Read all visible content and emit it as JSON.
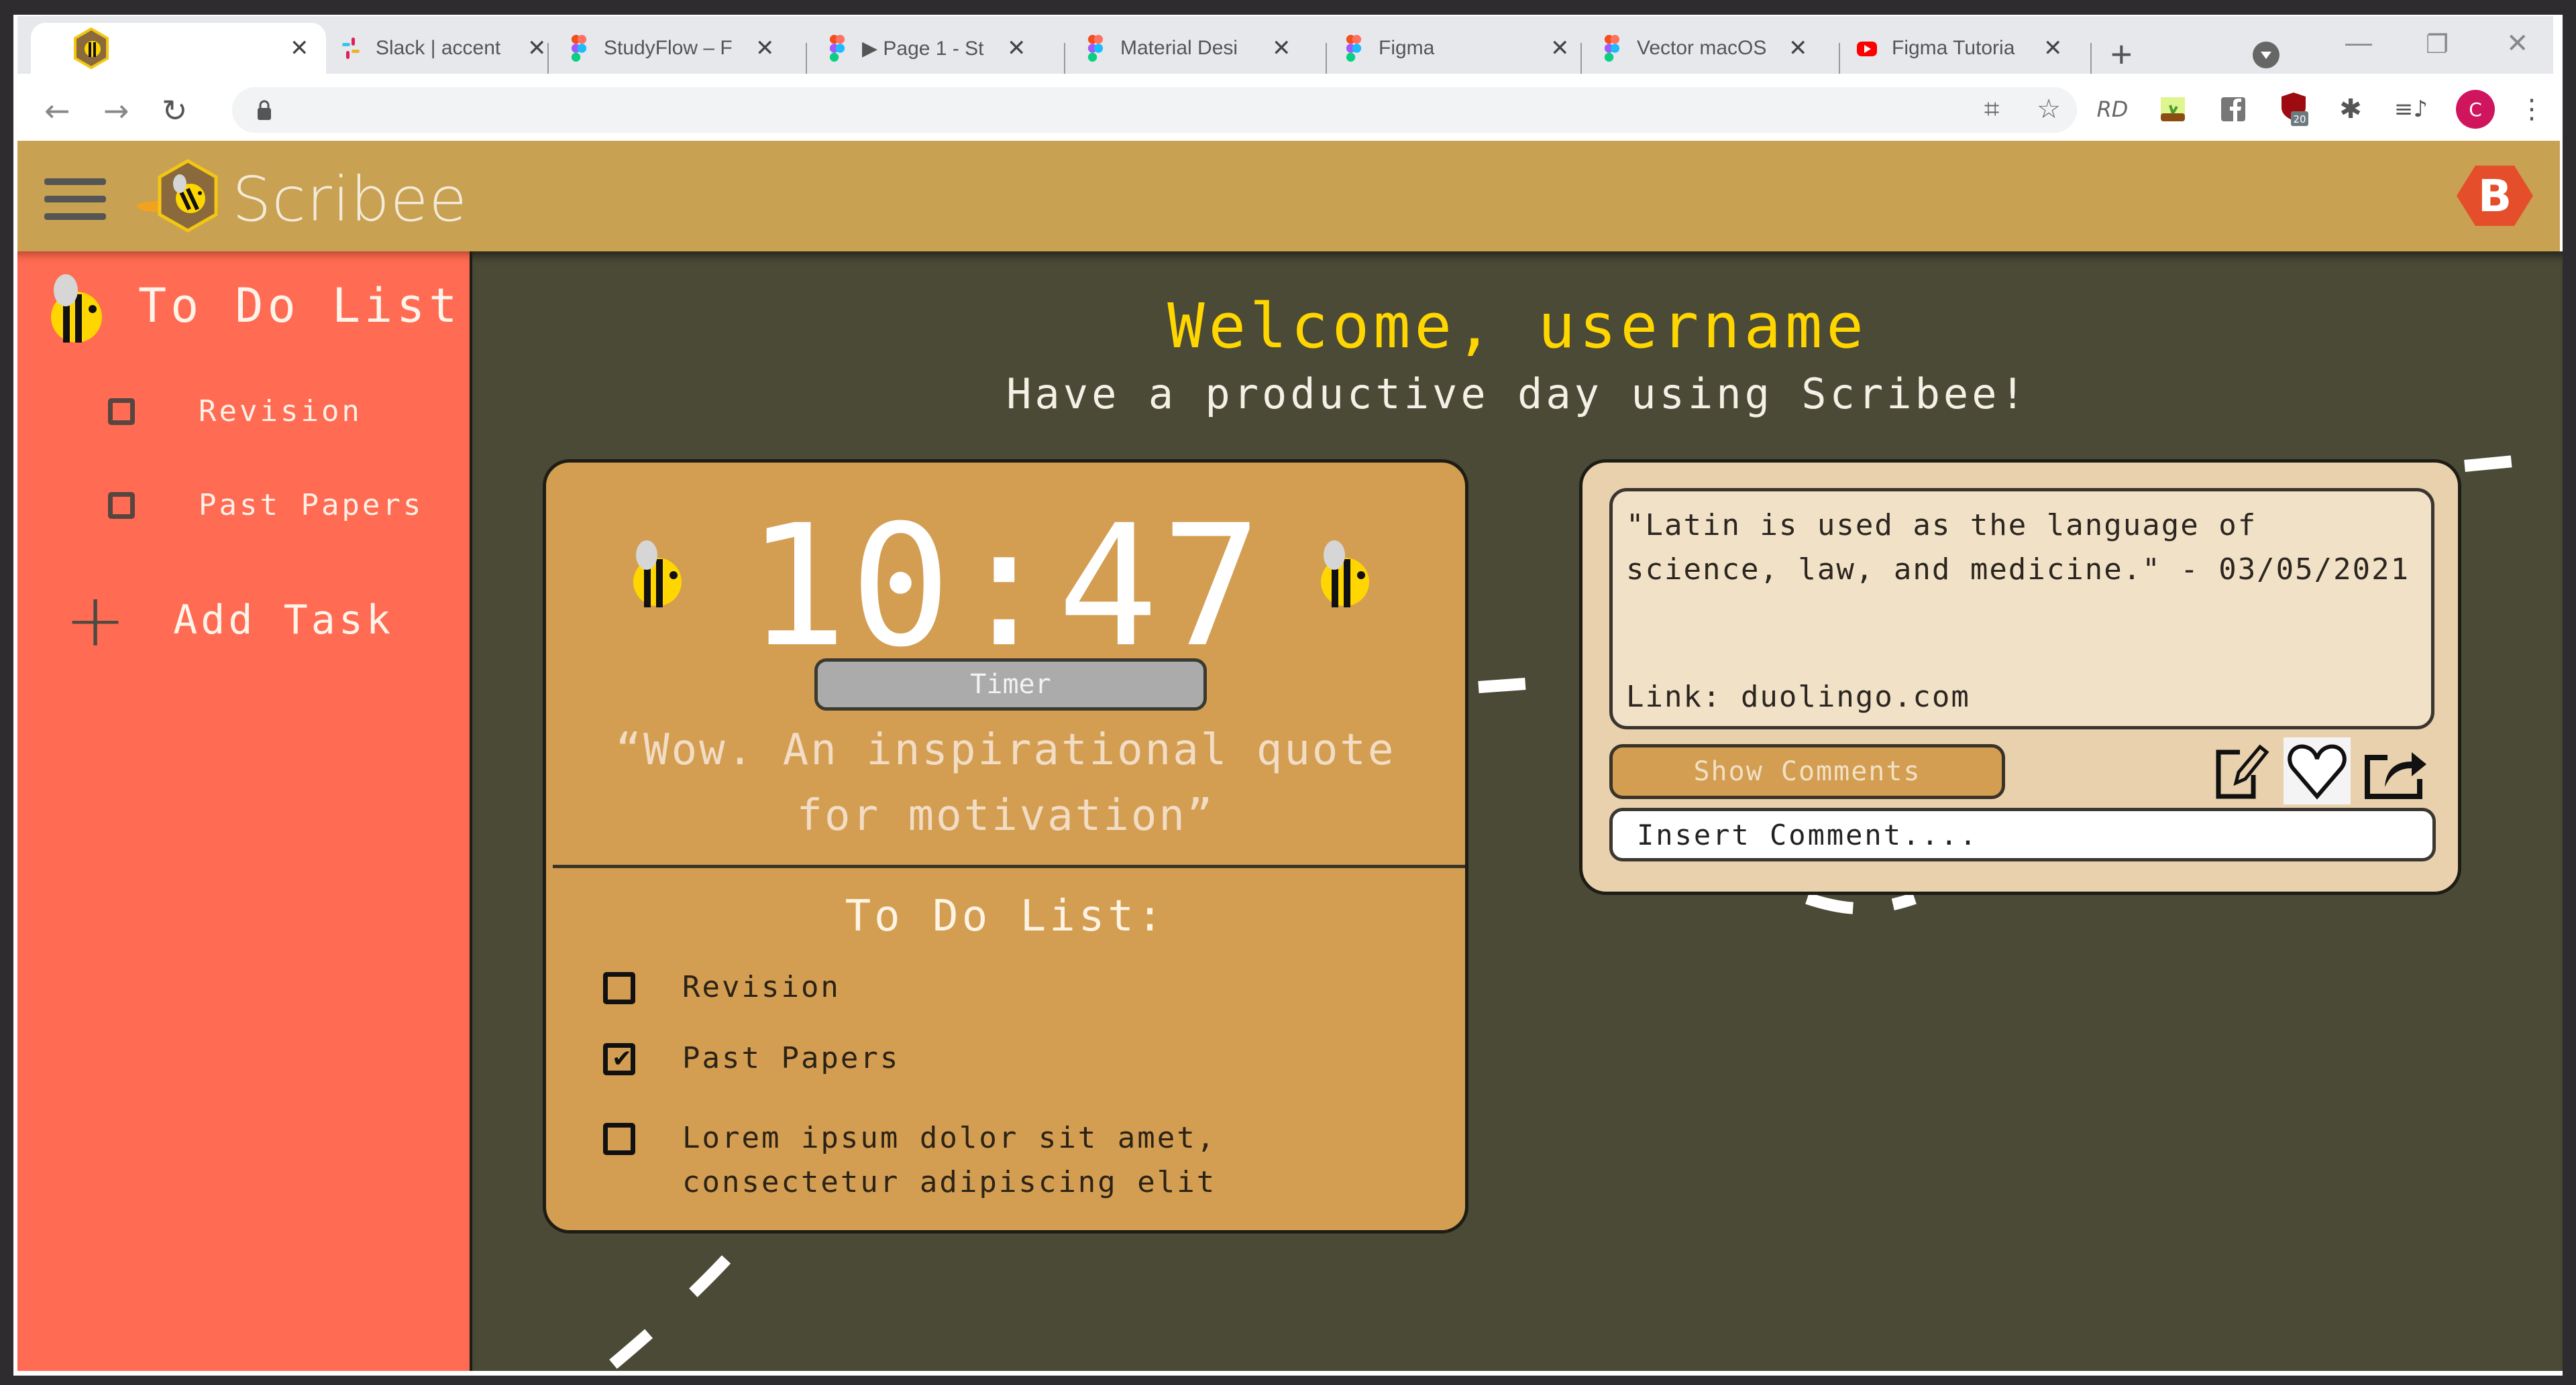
{
  "browser": {
    "tabs": [
      {
        "title": "",
        "icon": "scribee-favicon",
        "active": true
      },
      {
        "title": "Slack | accent",
        "icon": "slack-icon"
      },
      {
        "title": "StudyFlow – F",
        "icon": "figma-icon"
      },
      {
        "title": "▶ Page 1 - St",
        "icon": "figma-icon"
      },
      {
        "title": "Material Desi",
        "icon": "figma-icon"
      },
      {
        "title": "Figma",
        "icon": "figma-icon"
      },
      {
        "title": "Vector macOS",
        "icon": "figma-icon"
      },
      {
        "title": "Figma Tutoria",
        "icon": "youtube-icon"
      }
    ],
    "new_tab_label": "+",
    "close_glyph": "✕",
    "address": "",
    "extension_badge": "20",
    "profile_initial": "C"
  },
  "app": {
    "name": "Scribee",
    "user_initial": "B",
    "colors": {
      "header": "#c8a152",
      "sidebar": "#ff6b53",
      "main_bg": "#4b4a36",
      "card": "#d39e52",
      "note_card": "#e9d1ad",
      "welcome": "#ffd600"
    }
  },
  "sidebar": {
    "title": "To Do List",
    "items": [
      {
        "label": "Revision",
        "checked": false
      },
      {
        "label": "Past Papers",
        "checked": false
      }
    ],
    "add_task_label": "Add Task"
  },
  "main": {
    "welcome": "Welcome, username",
    "subtitle": "Have a productive day using Scribee!",
    "clock_card": {
      "time": "10:47",
      "timer_label": "Timer",
      "quote": "“Wow. An inspirational quote for motivation”",
      "todo_title": "To Do List:",
      "todos": [
        {
          "label": "Revision",
          "checked": false
        },
        {
          "label": "Past Papers",
          "checked": true
        },
        {
          "label": "Lorem ipsum dolor sit amet, consectetur adipiscing elit",
          "checked": false
        }
      ]
    },
    "note_card": {
      "text": "\"Latin is used as the language of science, law, and medicine.\" - 03/05/2021",
      "link": "Link: duolingo.com",
      "show_comments_label": "Show Comments",
      "comment_placeholder": "Insert Comment...."
    }
  }
}
